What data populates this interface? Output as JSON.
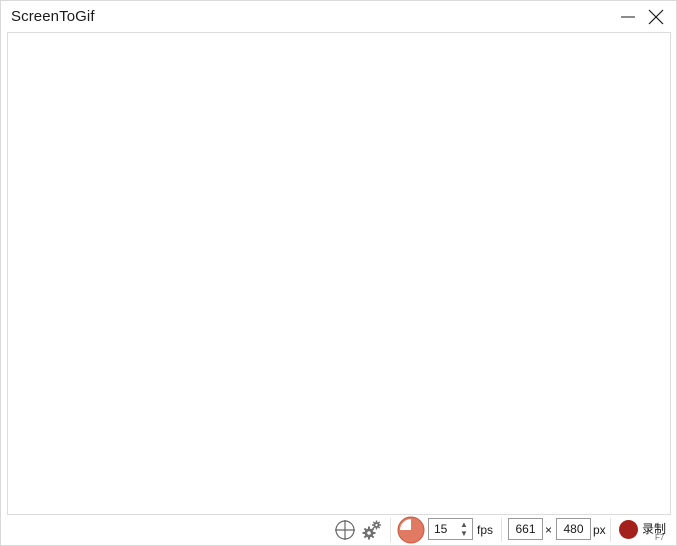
{
  "window": {
    "title": "ScreenToGif"
  },
  "toolbar": {
    "icons": [
      "crosshair-icon",
      "settings-gears-icon",
      "frame-rate-clock-icon"
    ],
    "fps_value": "15",
    "fps_unit": "fps",
    "width_value": "661",
    "size_separator": "×",
    "height_value": "480",
    "size_unit": "px",
    "record_label": "录制",
    "record_shortcut": "F7",
    "record_color": "#a3201c",
    "clock_accent": "#e07a62"
  }
}
